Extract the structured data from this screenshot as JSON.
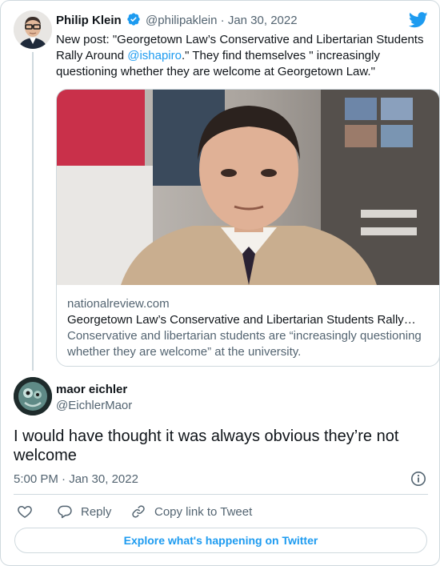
{
  "parent_tweet": {
    "display_name": "Philip Klein",
    "handle": "@philipaklein",
    "separator": "·",
    "date": "Jan 30, 2022",
    "text_before_mention": "New post: \"Georgetown Law’s Conservative and Libertarian Students Rally Around ",
    "mention": "@ishapiro",
    "text_after_mention": ".\" They find themselves \" increasingly questioning whether they are welcome at Georgetown Law.\"",
    "link_card": {
      "domain": "nationalreview.com",
      "title": "Georgetown Law’s Conservative and Libertarian Students Rally…",
      "description": "Conservative and libertarian students are “increasingly questioning whether they are welcome” at the university."
    }
  },
  "reply_tweet": {
    "display_name": "maor eichler",
    "handle": "@EichlerMaor",
    "text": "I would have thought it was always obvious they’re not welcome",
    "timestamp": "5:00 PM · Jan 30, 2022"
  },
  "actions": {
    "reply_label": "Reply",
    "copy_link_label": "Copy link to Tweet"
  },
  "footer": {
    "explore_label": "Explore what's happening on Twitter"
  },
  "colors": {
    "accent": "#1d9bf0",
    "text_primary": "#0f1419",
    "text_secondary": "#536471",
    "border": "#cfd9de"
  },
  "icons": [
    "verified-badge-icon",
    "twitter-bird-icon",
    "info-icon",
    "heart-icon",
    "reply-icon",
    "link-icon"
  ]
}
